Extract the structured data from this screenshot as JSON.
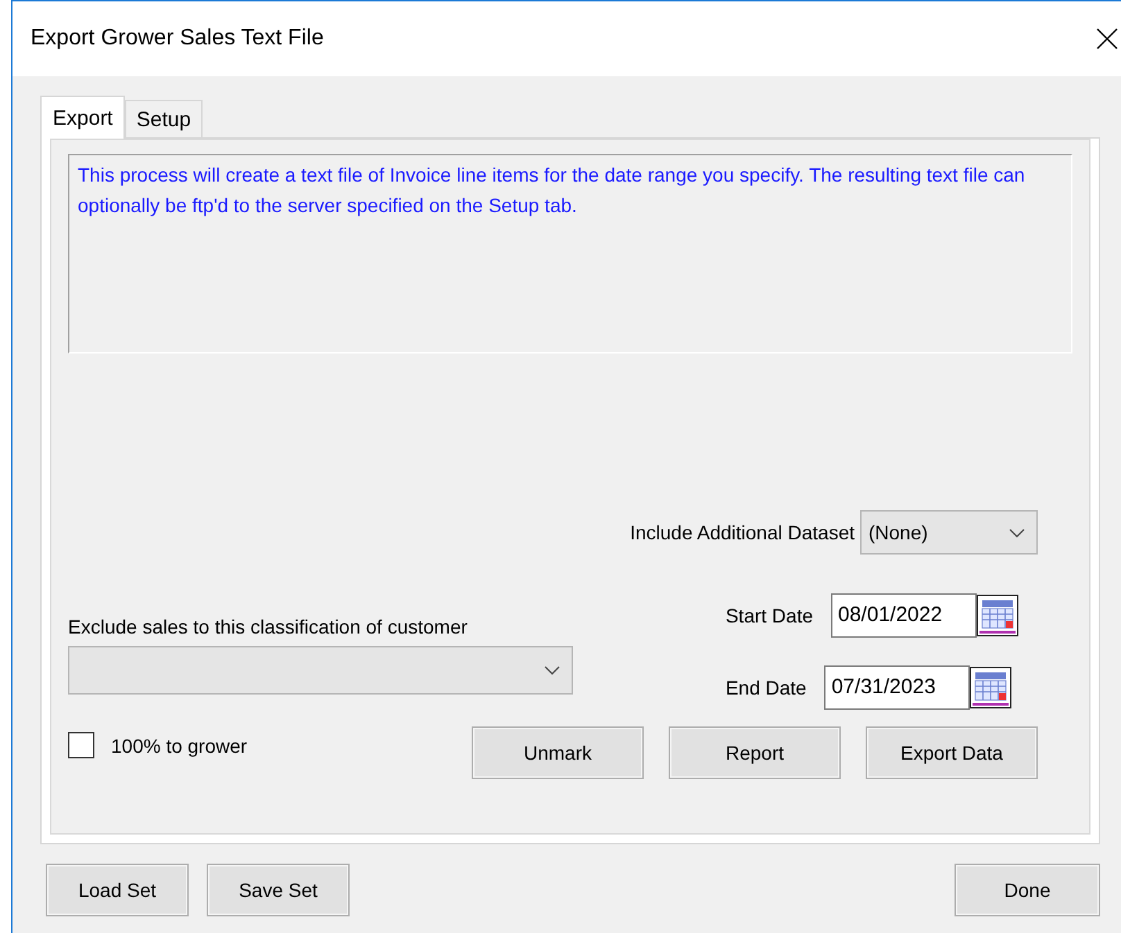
{
  "window": {
    "title": "Export Grower Sales Text File"
  },
  "tabs": [
    {
      "label": "Export",
      "selected": true
    },
    {
      "label": "Setup",
      "selected": false
    }
  ],
  "description": "This process will create a text file of Invoice line items for the date range you specify. The resulting text file can optionally be ftp'd to the server specified on the Setup tab.",
  "dataset": {
    "label": "Include Additional Dataset",
    "value": "(None)"
  },
  "exclude": {
    "label": "Exclude sales to this classification of customer",
    "disabled": true
  },
  "start_date": {
    "label": "Start Date",
    "value": "08/01/2022"
  },
  "end_date": {
    "label": "End Date",
    "value": "07/31/2023"
  },
  "grower_checkbox": {
    "label": "100% to grower",
    "checked": false
  },
  "action_buttons": [
    "Unmark",
    "Report",
    "Export Data"
  ],
  "footer_left_buttons": [
    "Load Set",
    "Save Set"
  ],
  "footer_right_button": "Done"
}
